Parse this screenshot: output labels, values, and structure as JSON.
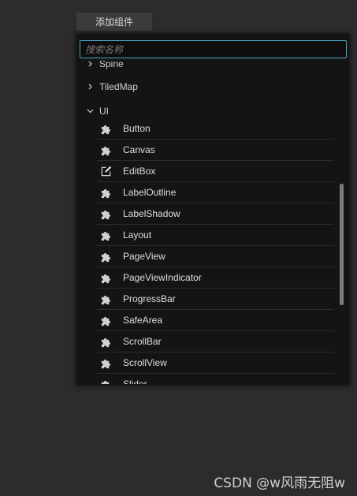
{
  "add_component_button": "添加组件",
  "search": {
    "placeholder": "搜索名称",
    "value": ""
  },
  "groups": [
    {
      "label": "Spine",
      "expanded": false
    },
    {
      "label": "TiledMap",
      "expanded": false
    },
    {
      "label": "UI",
      "expanded": true
    }
  ],
  "ui_items": [
    {
      "label": "Button",
      "icon": "puzzle-icon"
    },
    {
      "label": "Canvas",
      "icon": "puzzle-icon"
    },
    {
      "label": "EditBox",
      "icon": "edit-box-icon"
    },
    {
      "label": "LabelOutline",
      "icon": "puzzle-icon"
    },
    {
      "label": "LabelShadow",
      "icon": "puzzle-icon"
    },
    {
      "label": "Layout",
      "icon": "puzzle-icon"
    },
    {
      "label": "PageView",
      "icon": "puzzle-icon"
    },
    {
      "label": "PageViewIndicator",
      "icon": "puzzle-icon"
    },
    {
      "label": "ProgressBar",
      "icon": "puzzle-icon"
    },
    {
      "label": "SafeArea",
      "icon": "puzzle-icon"
    },
    {
      "label": "ScrollBar",
      "icon": "puzzle-icon"
    },
    {
      "label": "ScrollView",
      "icon": "puzzle-icon"
    },
    {
      "label": "Slider",
      "icon": "puzzle-icon"
    }
  ],
  "watermark": "CSDN @w风雨无阻w",
  "colors": {
    "accent": "#4aa7c4",
    "panel_bg": "#141414",
    "page_bg": "#2c2c2c"
  }
}
